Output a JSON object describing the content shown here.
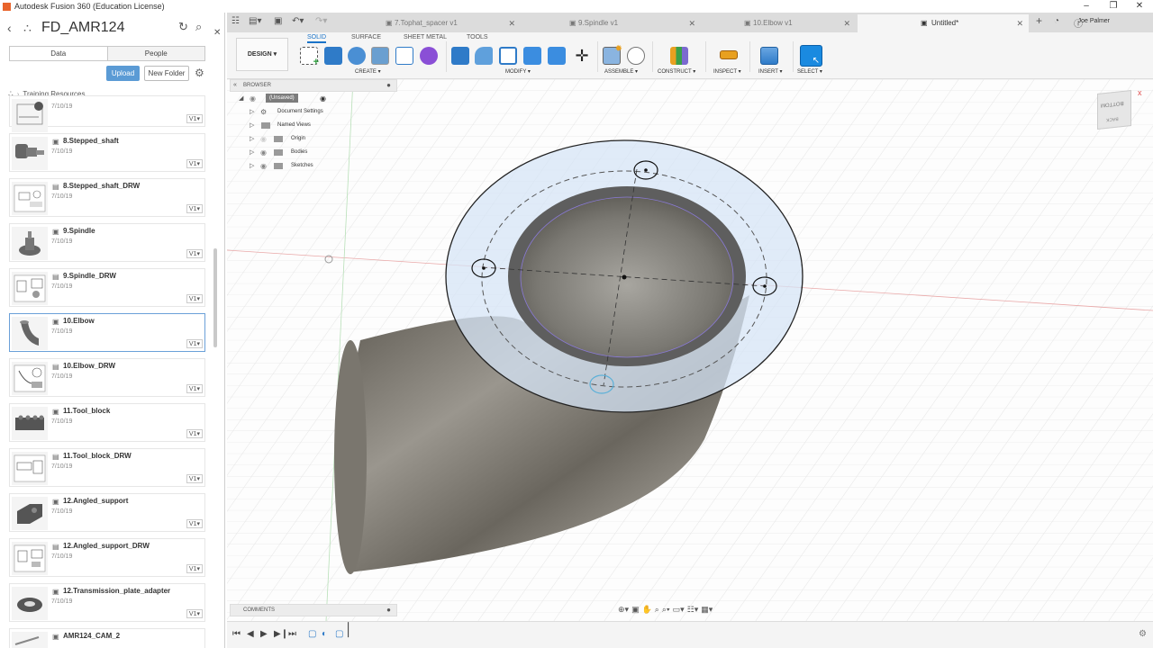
{
  "window": {
    "title": "Autodesk Fusion 360 (Education License)",
    "controls": [
      "–",
      "❐",
      "✕"
    ]
  },
  "data_panel": {
    "project_title": "FD_AMR124",
    "tabs": [
      "Data",
      "People"
    ],
    "upload_label": "Upload",
    "new_folder_label": "New Folder",
    "breadcrumb": "Training Resources",
    "files": [
      {
        "name": "",
        "date": "7/10/19",
        "version": "V1"
      },
      {
        "name": "8.Stepped_shaft",
        "date": "7/10/19",
        "version": "V1"
      },
      {
        "name": "8.Stepped_shaft_DRW",
        "date": "7/10/19",
        "version": "V1"
      },
      {
        "name": "9.Spindle",
        "date": "7/10/19",
        "version": "V1"
      },
      {
        "name": "9.Spindle_DRW",
        "date": "7/10/19",
        "version": "V1"
      },
      {
        "name": "10.Elbow",
        "date": "7/10/19",
        "version": "V1"
      },
      {
        "name": "10.Elbow_DRW",
        "date": "7/10/19",
        "version": "V1"
      },
      {
        "name": "11.Tool_block",
        "date": "7/10/19",
        "version": "V1"
      },
      {
        "name": "11.Tool_block_DRW",
        "date": "7/10/19",
        "version": "V1"
      },
      {
        "name": "12.Angled_support",
        "date": "7/10/19",
        "version": "V1"
      },
      {
        "name": "12.Angled_support_DRW",
        "date": "7/10/19",
        "version": "V1"
      },
      {
        "name": "12.Transmission_plate_adapter",
        "date": "7/10/19",
        "version": "V1"
      },
      {
        "name": "AMR124_CAM_2",
        "date": "",
        "version": ""
      }
    ]
  },
  "doc_tabs": {
    "tabs": [
      {
        "label": "7.Tophat_spacer v1",
        "active": false
      },
      {
        "label": "9.Spindle v1",
        "active": false
      },
      {
        "label": "10.Elbow v1",
        "active": false
      },
      {
        "label": "Untitled*",
        "active": true
      }
    ],
    "user": "Joe Palmer"
  },
  "toolbar": {
    "workspace": "DESIGN",
    "tabs": [
      "SOLID",
      "SURFACE",
      "SHEET METAL",
      "TOOLS"
    ],
    "groups": [
      "CREATE",
      "MODIFY",
      "ASSEMBLE",
      "CONSTRUCT",
      "INSPECT",
      "INSERT",
      "SELECT"
    ]
  },
  "browser": {
    "header": "BROWSER",
    "root": "(Unsaved)",
    "items": [
      "Document Settings",
      "Named Views",
      "Origin",
      "Bodies",
      "Sketches"
    ]
  },
  "comments": {
    "label": "COMMENTS"
  },
  "viewcube": {
    "face_label": "BOTTOM",
    "back_label": "BACK"
  },
  "colors": {
    "accent": "#1a73c8",
    "upload": "#5b9bd5",
    "selection": "#6aa0d8"
  }
}
